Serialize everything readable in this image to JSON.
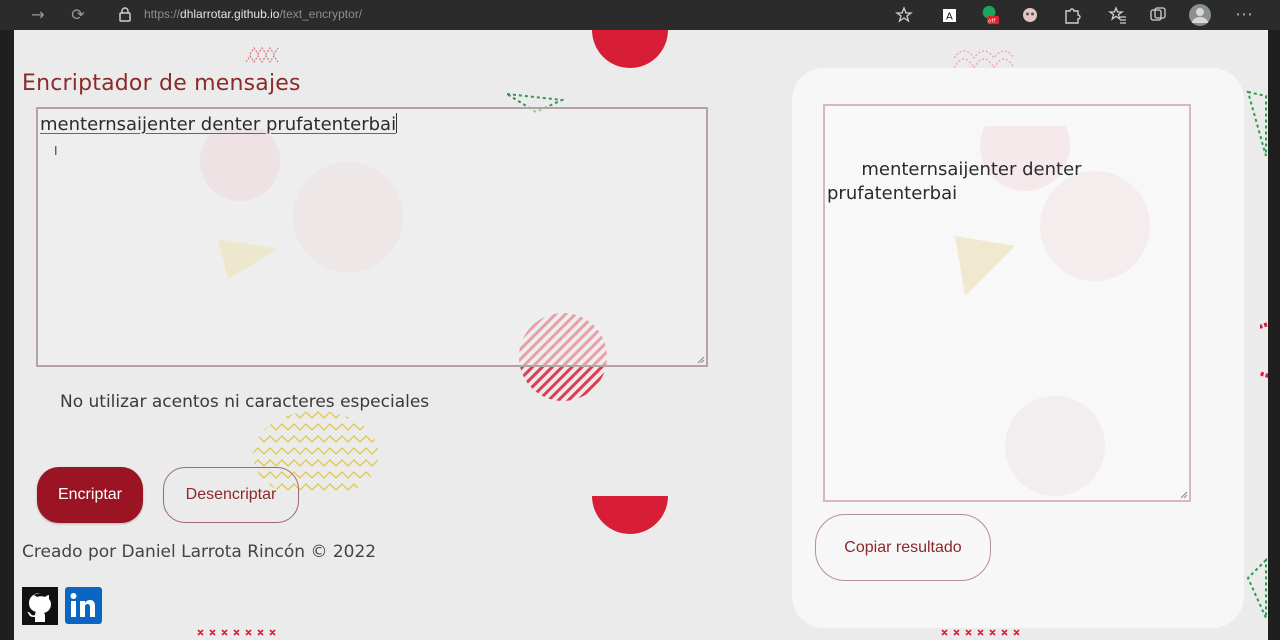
{
  "browser": {
    "url_prefix": "https://",
    "url_host": "dhlarrotar.github.io",
    "url_path": "/text_encryptor/",
    "extension_badge": "off"
  },
  "app": {
    "title": "Encriptador de mensajes",
    "input_text": "menternsaijenter denter prufatenterbai",
    "warning": "No utilizar acentos ni caracteres especiales",
    "encrypt_label": "Encriptar",
    "decrypt_label": "Desencriptar",
    "credits": "Creado por Daniel Larrota Rincón © 2022",
    "output_text": "menternsaijenter denter prufatenterbai",
    "copy_label": "Copiar resultado"
  },
  "colors": {
    "accent": "#9b1423",
    "title": "#8a2a2a",
    "deco_red": "#d81e36",
    "linkedin": "#0a66c2"
  },
  "icons": {
    "github": "github-icon",
    "linkedin": "linkedin-icon"
  }
}
